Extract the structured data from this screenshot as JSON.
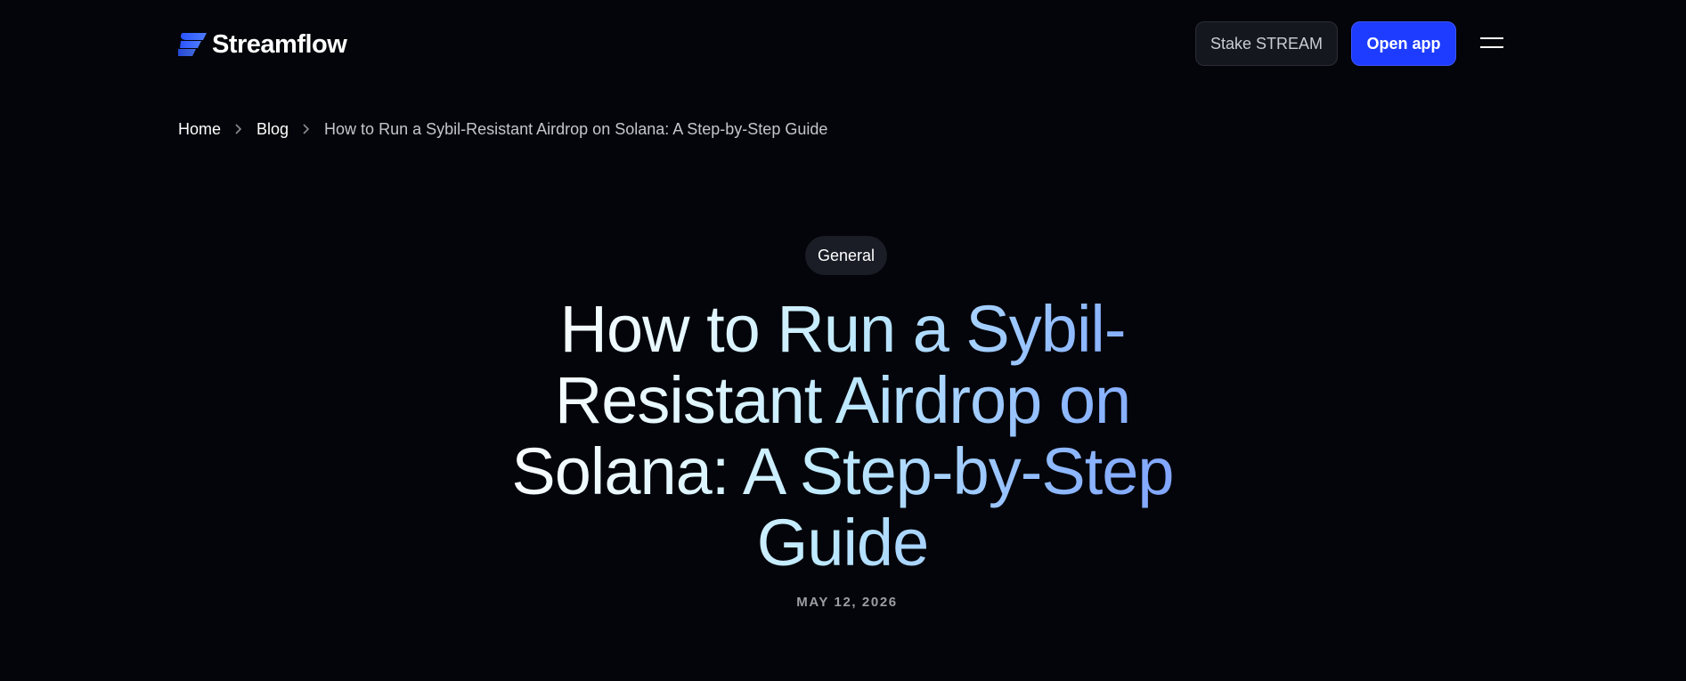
{
  "header": {
    "logo_text": "Streamflow",
    "stake_label": "Stake STREAM",
    "open_app_label": "Open app",
    "menu_icon": "hamburger-menu-icon",
    "logo_icon": "streamflow-logo-icon"
  },
  "breadcrumb": {
    "items": [
      {
        "label": "Home"
      },
      {
        "label": "Blog"
      }
    ],
    "current": "How to Run a Sybil-Resistant Airdrop on Solana: A Step-by-Step Guide",
    "separator_icon": "chevron-right-icon"
  },
  "article": {
    "category": "General",
    "title": "How to Run a Sybil-Resistant Airdrop on Solana: A Step-by-Step Guide",
    "date": "MAY 12, 2026"
  },
  "colors": {
    "background": "#04050a",
    "accent_blue": "#1d3cff",
    "stake_button_bg": "#15171f",
    "pill_bg": "#1a1d25",
    "date_text": "#9c9ea4",
    "title_gradient_start": "#ffffff",
    "title_gradient_end": "#7c9eff"
  }
}
